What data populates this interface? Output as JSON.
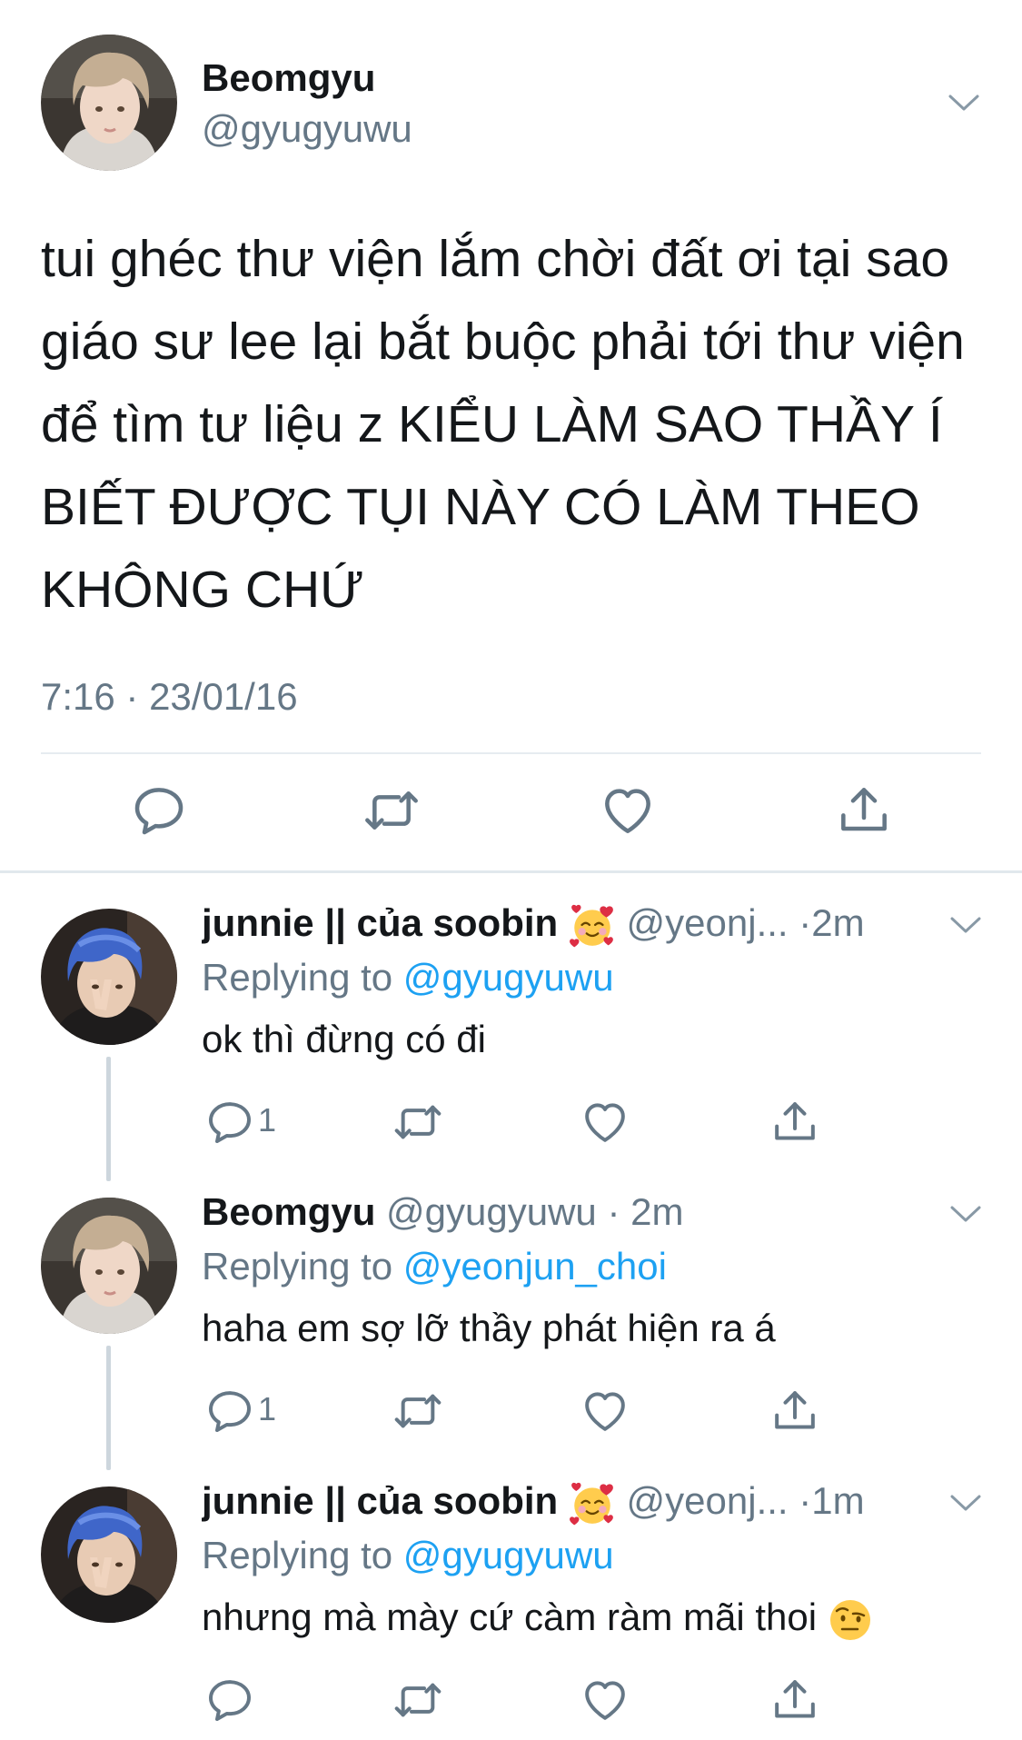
{
  "main_tweet": {
    "author_name": "Beomgyu",
    "author_handle": "@gyugyuwu",
    "text": "tui ghéc thư viện lắm chời đất ơi tại sao giáo sư lee lại bắt buộc phải tới thư viện để tìm tư liệu z KIỂU LÀM SAO THẦY Í BIẾT ĐƯỢC TỤI NÀY CÓ LÀM THEO KHÔNG CHỨ",
    "timestamp": "7:16 · 23/01/16",
    "actions": [
      "reply-icon",
      "retweet-icon",
      "like-icon",
      "share-icon"
    ]
  },
  "replies": [
    {
      "author_name": "junnie || của soobin",
      "author_emoji": "smiling-face-with-hearts",
      "meta": "@yeonj... ·2m",
      "replying_prefix": "Replying to",
      "replying_to": "@gyugyuwu",
      "text": "ok thì đừng có đi",
      "reply_count": "1"
    },
    {
      "author_name": "Beomgyu",
      "meta": "@gyugyuwu · 2m",
      "replying_prefix": "Replying to",
      "replying_to": "@yeonjun_choi",
      "text": "haha em sợ lỡ thầy phát hiện ra á",
      "reply_count": "1"
    },
    {
      "author_name": "junnie || của soobin",
      "author_emoji": "smiling-face-with-hearts",
      "meta": "@yeonj... ·1m",
      "replying_prefix": "Replying to",
      "replying_to": "@gyugyuwu",
      "text": "nhưng mà mày cứ càm ràm mãi thoi",
      "text_emoji": "face-with-raised-eyebrow",
      "reply_count": ""
    }
  ],
  "colors": {
    "text": "#14171a",
    "secondary": "#657786",
    "link": "#1da1f2",
    "divider": "#e6ecf0",
    "thread_line": "#cdd6dd"
  }
}
